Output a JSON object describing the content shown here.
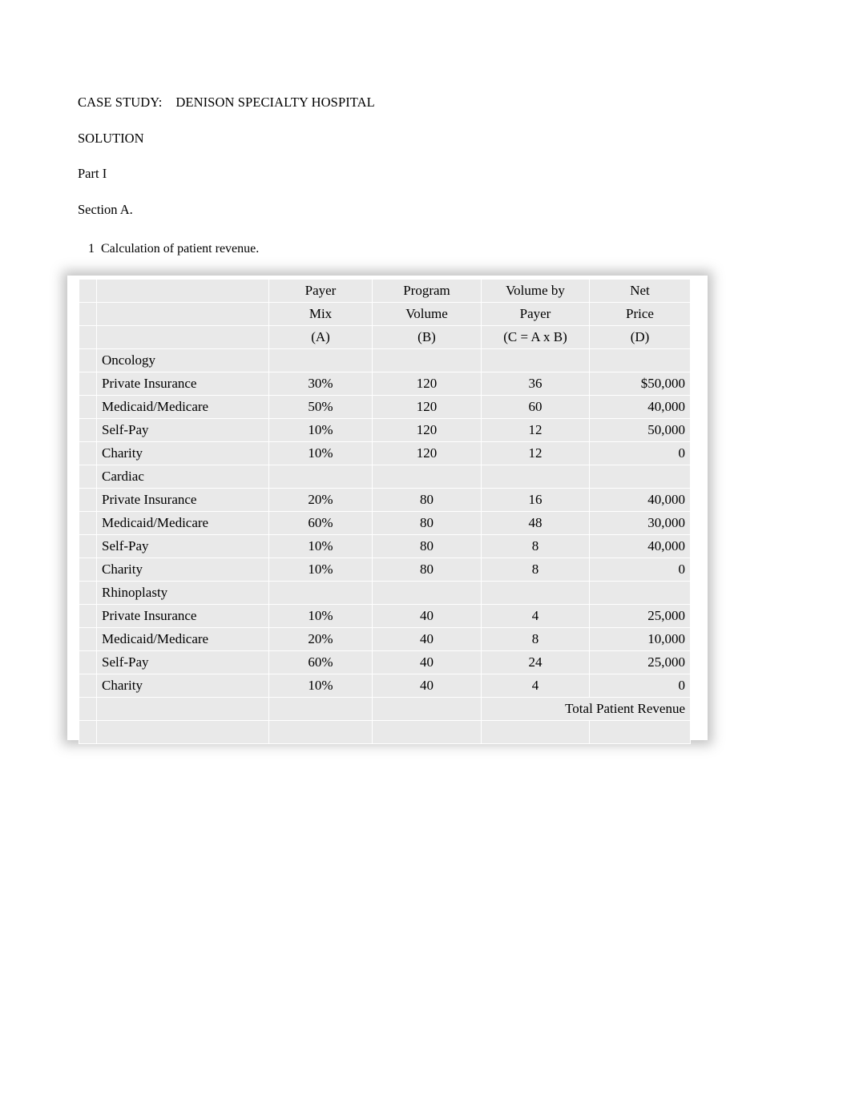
{
  "document": {
    "heading_lines": [
      "CASE STUDY:    DENISON SPECIALTY HOSPITAL",
      "SOLUTION",
      "Part I",
      "Section A."
    ],
    "numbered_item": "1  Calculation of patient revenue.",
    "table": {
      "header_rows": [
        [
          "",
          "Payer",
          "Program",
          "Volume by",
          "Net"
        ],
        [
          "",
          "Mix",
          "Volume",
          "Payer",
          "Price"
        ],
        [
          "",
          "(A)",
          "(B)",
          "(C = A x B)",
          "(D)"
        ]
      ],
      "rows": [
        {
          "type": "group",
          "label": "Oncology",
          "mix": "",
          "volume": "",
          "by_payer": "",
          "price": ""
        },
        {
          "type": "item",
          "label": "Private Insurance",
          "mix": "30%",
          "volume": "120",
          "by_payer": "36",
          "price": "$50,000"
        },
        {
          "type": "item",
          "label": "Medicaid/Medicare",
          "mix": "50%",
          "volume": "120",
          "by_payer": "60",
          "price": "40,000"
        },
        {
          "type": "item",
          "label": "Self-Pay",
          "mix": "10%",
          "volume": "120",
          "by_payer": "12",
          "price": "50,000"
        },
        {
          "type": "item",
          "label": "Charity",
          "mix": "10%",
          "volume": "120",
          "by_payer": "12",
          "price": "0"
        },
        {
          "type": "group",
          "label": "Cardiac",
          "mix": "",
          "volume": "",
          "by_payer": "",
          "price": ""
        },
        {
          "type": "item",
          "label": "Private Insurance",
          "mix": "20%",
          "volume": "80",
          "by_payer": "16",
          "price": "40,000"
        },
        {
          "type": "item",
          "label": "Medicaid/Medicare",
          "mix": "60%",
          "volume": "80",
          "by_payer": "48",
          "price": "30,000"
        },
        {
          "type": "item",
          "label": "Self-Pay",
          "mix": "10%",
          "volume": "80",
          "by_payer": "8",
          "price": "40,000"
        },
        {
          "type": "item",
          "label": "Charity",
          "mix": "10%",
          "volume": "80",
          "by_payer": "8",
          "price": "0"
        },
        {
          "type": "group",
          "label": "Rhinoplasty",
          "mix": "",
          "volume": "",
          "by_payer": "",
          "price": ""
        },
        {
          "type": "item",
          "label": "Private Insurance",
          "mix": "10%",
          "volume": "40",
          "by_payer": "4",
          "price": "25,000"
        },
        {
          "type": "item",
          "label": "Medicaid/Medicare",
          "mix": "20%",
          "volume": "40",
          "by_payer": "8",
          "price": "10,000"
        },
        {
          "type": "item",
          "label": "Self-Pay",
          "mix": "60%",
          "volume": "40",
          "by_payer": "24",
          "price": "25,000"
        },
        {
          "type": "item",
          "label": "Charity",
          "mix": "10%",
          "volume": "40",
          "by_payer": "4",
          "price": "0"
        }
      ],
      "total_label": "Total Patient Revenue"
    }
  }
}
